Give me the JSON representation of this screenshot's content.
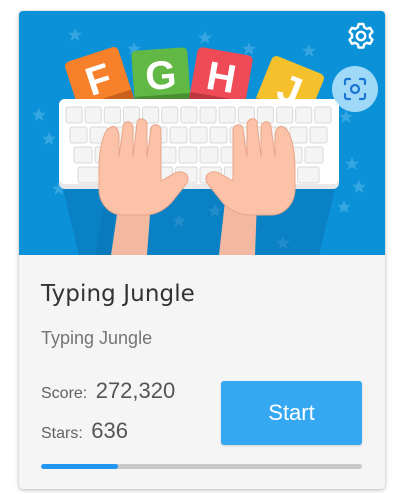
{
  "game": {
    "title": "Typing Jungle",
    "subtitle": "Typing Jungle",
    "score_label": "Score:",
    "score_value": "272,320",
    "stars_label": "Stars:",
    "stars_value": "636",
    "start_label": "Start",
    "progress_fraction": 0.24
  },
  "hero": {
    "letter_blocks": [
      "F",
      "G",
      "H",
      "J"
    ],
    "letter_block_colors": [
      "#f7802a",
      "#62b845",
      "#ef4b56",
      "#f4c02c"
    ],
    "background_color": "#0a91d8"
  },
  "icons": {
    "settings": "gear-icon",
    "scan": "scan-icon"
  },
  "colors": {
    "accent": "#36a7f1",
    "progress_fill": "#2196f3",
    "progress_track": "#c9c9c9"
  }
}
